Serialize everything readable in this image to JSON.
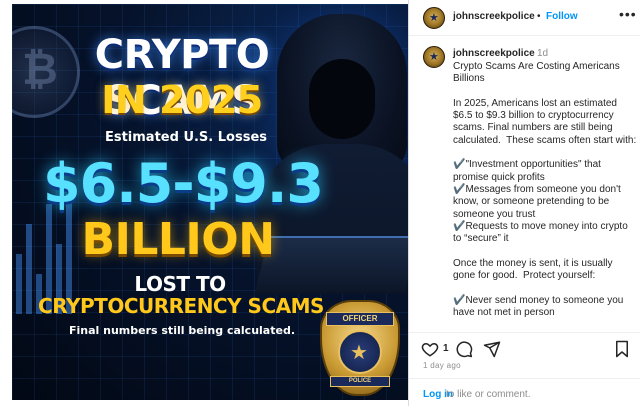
{
  "post_image": {
    "headline_line1": "CRYPTO SCAMS",
    "headline_line2": "IN 2025",
    "subhead": "Estimated U.S. Losses",
    "amount": "$6.5-$9.3",
    "billion": "BILLION",
    "lost_to": "LOST TO",
    "scams_line": "CRYPTOCURRENCY SCAMS",
    "footnote": "Final numbers still being calculated.",
    "badge_top": "OFFICER",
    "badge_bottom": "POLICE",
    "colors": {
      "background": "#06132c",
      "headline_white": "#ffffff",
      "accent_yellow": "#ffc81a",
      "amount_cyan": "#58e0ff"
    }
  },
  "header": {
    "username": "johnscreekpolice",
    "separator": "•",
    "follow_label": "Follow",
    "more_icon": "more-horizontal-icon",
    "more_label": "•••"
  },
  "caption": {
    "username": "johnscreekpolice",
    "timestamp": "1d",
    "text": "Crypto Scams Are Costing Americans Billions\n\nIn 2025, Americans lost an estimated $6.5 to $9.3 billion to cryptocurrency scams. Final numbers are still being calculated.  These scams often start with:\n\n✔️\"Investment opportunities\" that promise quick profits\n✔️Messages from someone you don't know, or someone pretending to be someone you trust\n✔️Requests to move money into crypto to “secure” it\n\nOnce the money is sent, it is usually gone for good.  Protect yourself:\n\n✔️Never send money to someone you have not met in person"
  },
  "actions": {
    "like_icon": "heart-icon",
    "like_count": "1",
    "comment_icon": "comment-icon",
    "share_icon": "share-icon",
    "save_icon": "bookmark-icon",
    "posted": "1 day ago"
  },
  "footer": {
    "login_label": "Log in",
    "rest_text": "to like or comment."
  }
}
